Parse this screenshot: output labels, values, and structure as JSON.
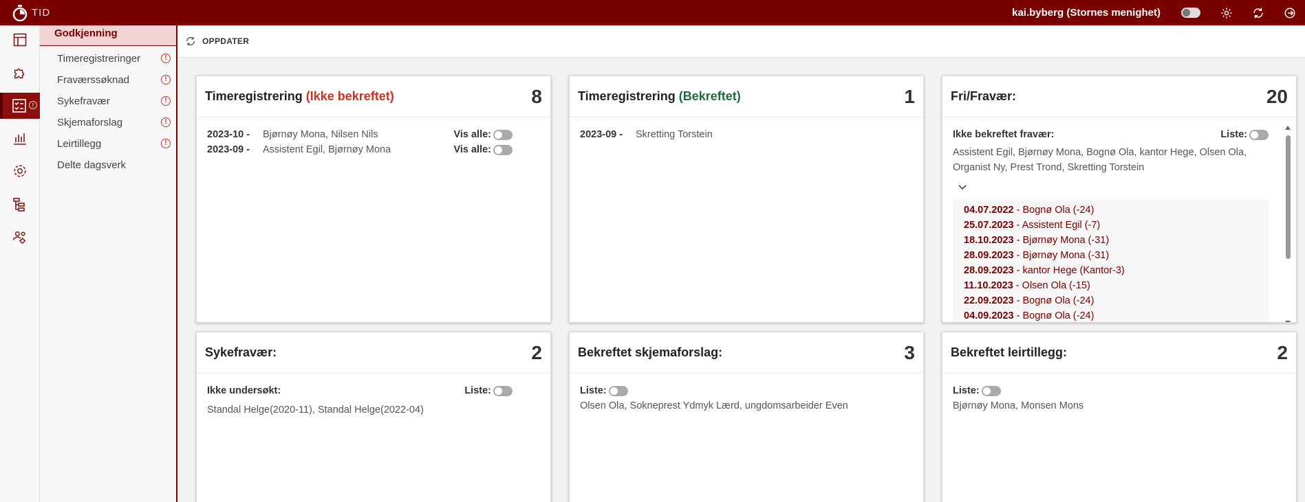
{
  "app": {
    "logo_text": "TID",
    "user": "kai.byberg (Stornes menighet)"
  },
  "submenu": {
    "header": "Godkjenning",
    "items": [
      {
        "label": "Timeregistreringer",
        "warning": true
      },
      {
        "label": "Fraværssøknad",
        "warning": true
      },
      {
        "label": "Sykefravær",
        "warning": true
      },
      {
        "label": "Skjemaforslag",
        "warning": true
      },
      {
        "label": "Leirtillegg",
        "warning": true
      },
      {
        "label": "Delte dagsverk",
        "warning": false
      }
    ],
    "warning_glyph": "!"
  },
  "toolbar": {
    "refresh_label": "OPPDATER"
  },
  "cards": {
    "time_unconfirmed": {
      "title": "Timeregistrering ",
      "status": "(Ikke bekreftet)",
      "count": "8",
      "toggle_label": "Vis alle:",
      "rows": [
        {
          "month": "2023-10 -",
          "names": "Bjørnøy Mona, Nilsen Nils"
        },
        {
          "month": "2023-09 -",
          "names": "Assistent Egil, Bjørnøy Mona"
        }
      ]
    },
    "time_confirmed": {
      "title": "Timeregistrering ",
      "status": "(Bekreftet)",
      "count": "1",
      "rows": [
        {
          "month": "2023-09 -",
          "names": "Skretting Torstein"
        }
      ]
    },
    "fri": {
      "title": "Fri/Fravær:",
      "count": "20",
      "subtitle": "Ikke bekreftet fravær:",
      "toggle_label": "Liste:",
      "names": "Assistent Egil, Bjørnøy Mona, Bognø Ola, kantor Hege, Olsen Ola, Organist Ny, Prest Trond, Skretting Torstein",
      "entries": [
        {
          "date": "04.07.2022",
          "text": " - Bognø Ola  (-24)"
        },
        {
          "date": "25.07.2023",
          "text": " - Assistent Egil  (-7)"
        },
        {
          "date": "18.10.2023",
          "text": " - Bjørnøy Mona  (-31)"
        },
        {
          "date": "28.09.2023",
          "text": " - Bjørnøy Mona  (-31)"
        },
        {
          "date": "28.09.2023",
          "text": " - kantor Hege  (Kantor-3)"
        },
        {
          "date": "11.10.2023",
          "text": " - Olsen Ola  (-15)"
        },
        {
          "date": "22.09.2023",
          "text": " - Bognø Ola  (-24)"
        },
        {
          "date": "04.09.2023",
          "text": " - Bognø Ola  (-24)"
        }
      ]
    },
    "sick": {
      "title": "Sykefravær:",
      "count": "2",
      "subtitle": "Ikke undersøkt:",
      "toggle_label": "Liste:",
      "names": "Standal Helge(2020-11), Standal Helge(2022-04)"
    },
    "forms": {
      "title": "Bekreftet skjemaforslag:",
      "count": "3",
      "toggle_label": "Liste:",
      "names": "Olsen Ola, Sokneprest Ydmyk Lærd, ungdomsarbeider Even"
    },
    "camp": {
      "title": "Bekreftet leirtillegg:",
      "count": "2",
      "toggle_label": "Liste:",
      "names": "Bjørnøy Mona, Monsen Mons"
    }
  },
  "colors": {
    "brand": "#7a0000",
    "unconfirmed": "#d0301e",
    "confirmed": "#1e6b3a"
  }
}
